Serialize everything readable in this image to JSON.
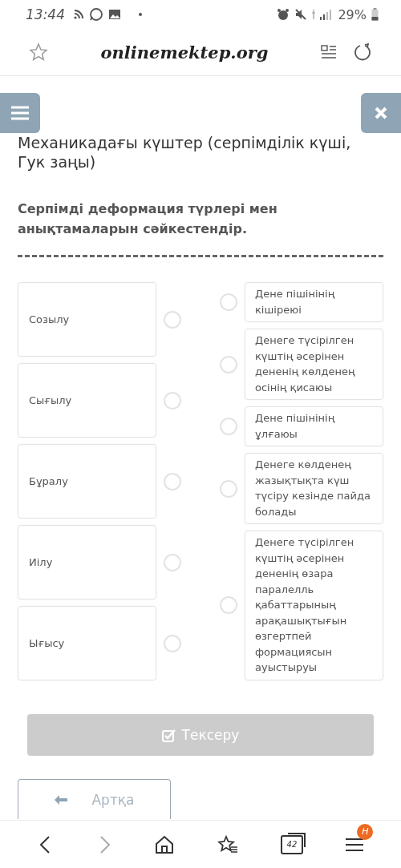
{
  "status_bar": {
    "time": "13:44",
    "battery": "29%"
  },
  "browser": {
    "url": "onlinemektep.org",
    "tabs_count": "42",
    "menu_badge": "H"
  },
  "title": "Механикадағы күштер (серпімділік күші, Гук заңы)",
  "instruction": "Серпімді деформация түрлері мен анықтамаларын сәйкестендір.",
  "terms": [
    {
      "text": "Созылу",
      "selected": false
    },
    {
      "text": "Сығылу",
      "selected": false
    },
    {
      "text": "Бұралу",
      "selected": false
    },
    {
      "text": "Иілу",
      "selected": false
    },
    {
      "text": "Ығысу",
      "selected": false
    }
  ],
  "definitions": [
    {
      "text": "Дене пішінінің кішіреюі",
      "selected": false
    },
    {
      "text": "Денеге түсірілген күштің әсерінен дененің көлденең осінің қисаюы",
      "selected": false
    },
    {
      "text": "Дене пішінінің ұлғаюы",
      "selected": false
    },
    {
      "text": "Денеге көлденең жазықтықта күш түсіру кезінде пайда болады",
      "selected": false
    },
    {
      "text": "Денеге түсірілген күштің әсерінен дененің өзара паралелль қабаттарының арақашықтығын өзгертпей формациясын ауыстыруы",
      "selected": false
    }
  ],
  "check_button": {
    "label": "Тексеру",
    "disabled": true
  },
  "back_button": {
    "label": "Артқа"
  }
}
